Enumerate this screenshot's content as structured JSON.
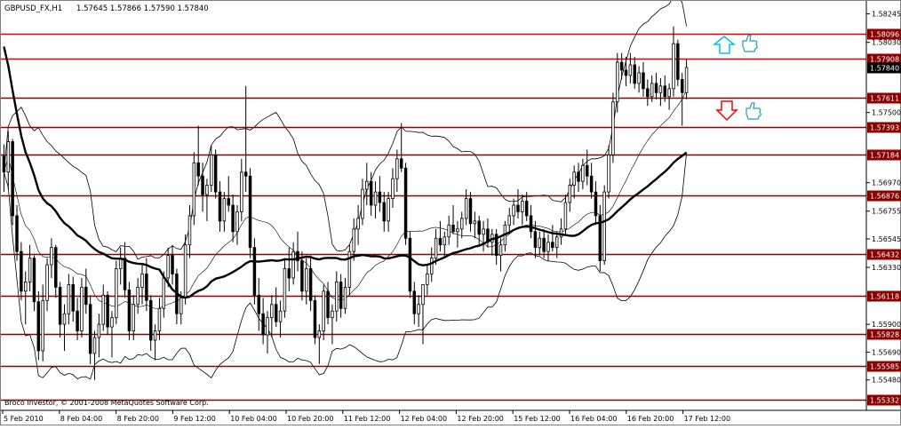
{
  "header": {
    "symbol": "GBPUSD_FX,H1",
    "ohlc": "1.57645 1.57866 1.57590 1.57840"
  },
  "footer": "Broco Investor, © 2001-2008 MetaQuotes Software Corp.",
  "chart_data": {
    "type": "candlestick",
    "title": "GBPUSD_FX,H1",
    "ylim": [
      1.5525,
      1.5835
    ],
    "y_ticks": [
      "1.58245",
      "1.58030",
      "1.57500",
      "1.56970",
      "1.56755",
      "1.56545",
      "1.56330",
      "1.55900",
      "1.55690",
      "1.55480"
    ],
    "x_ticks": [
      "5 Feb 2010",
      "8 Feb 04:00",
      "8 Feb 20:00",
      "9 Feb 12:00",
      "10 Feb 04:00",
      "10 Feb 20:00",
      "11 Feb 12:00",
      "12 Feb 04:00",
      "12 Feb 20:00",
      "15 Feb 12:00",
      "16 Feb 04:00",
      "16 Feb 20:00",
      "17 Feb 12:00"
    ],
    "levels": [
      "1.58096",
      "1.57908",
      "1.57611",
      "1.57393",
      "1.57184",
      "1.56876",
      "1.56432",
      "1.56118",
      "1.55828",
      "1.55585",
      "1.55332"
    ],
    "current_price": "1.57840",
    "colors": {
      "level_line": "#8b0000",
      "level_label_bg": "#8b0000",
      "upper_level_line": "#e00000",
      "current_price_bg": "#000000",
      "candles": "#000000",
      "up_arrow": "#00bfff",
      "down_arrow": "#ff0000"
    },
    "bars": [
      [
        1.5717,
        1.5726,
        1.569,
        1.5705
      ],
      [
        1.5705,
        1.5736,
        1.5692,
        1.5728
      ],
      [
        1.5728,
        1.573,
        1.5665,
        1.5672
      ],
      [
        1.5672,
        1.568,
        1.5638,
        1.5645
      ],
      [
        1.5645,
        1.5652,
        1.5608,
        1.5615
      ],
      [
        1.5615,
        1.563,
        1.559,
        1.5622
      ],
      [
        1.5622,
        1.565,
        1.5615,
        1.564
      ],
      [
        1.564,
        1.5642,
        1.56,
        1.5607
      ],
      [
        1.5607,
        1.5615,
        1.5563,
        1.557
      ],
      [
        1.557,
        1.562,
        1.5562,
        1.5608
      ],
      [
        1.5608,
        1.564,
        1.56,
        1.5635
      ],
      [
        1.5635,
        1.5655,
        1.5625,
        1.5648
      ],
      [
        1.5648,
        1.565,
        1.561,
        1.5618
      ],
      [
        1.5618,
        1.5622,
        1.558,
        1.559
      ],
      [
        1.559,
        1.5605,
        1.557,
        1.5598
      ],
      [
        1.5598,
        1.5628,
        1.559,
        1.562
      ],
      [
        1.562,
        1.5626,
        1.5592,
        1.56
      ],
      [
        1.56,
        1.561,
        1.5578,
        1.5585
      ],
      [
        1.5585,
        1.5625,
        1.558,
        1.5618
      ],
      [
        1.5618,
        1.5632,
        1.5598,
        1.5605
      ],
      [
        1.5605,
        1.5612,
        1.556,
        1.5568
      ],
      [
        1.5568,
        1.5585,
        1.5548,
        1.558
      ],
      [
        1.558,
        1.5598,
        1.5565,
        1.559
      ],
      [
        1.559,
        1.562,
        1.5585,
        1.5612
      ],
      [
        1.5612,
        1.5615,
        1.5582,
        1.5588
      ],
      [
        1.5588,
        1.56,
        1.5565,
        1.5595
      ],
      [
        1.5595,
        1.5638,
        1.559,
        1.5632
      ],
      [
        1.5632,
        1.5648,
        1.562,
        1.564
      ],
      [
        1.564,
        1.5652,
        1.561,
        1.5616
      ],
      [
        1.5616,
        1.5622,
        1.5578,
        1.5585
      ],
      [
        1.5585,
        1.5612,
        1.5578,
        1.5605
      ],
      [
        1.5605,
        1.5625,
        1.5598,
        1.5618
      ],
      [
        1.5618,
        1.5635,
        1.5605,
        1.5628
      ],
      [
        1.5628,
        1.564,
        1.56,
        1.5608
      ],
      [
        1.5608,
        1.5612,
        1.557,
        1.5578
      ],
      [
        1.5578,
        1.559,
        1.5563,
        1.5585
      ],
      [
        1.5585,
        1.561,
        1.5578,
        1.5602
      ],
      [
        1.5602,
        1.563,
        1.5595,
        1.5625
      ],
      [
        1.5625,
        1.5648,
        1.5618,
        1.5642
      ],
      [
        1.5642,
        1.565,
        1.562,
        1.5628
      ],
      [
        1.5628,
        1.5632,
        1.559,
        1.5598
      ],
      [
        1.5598,
        1.5615,
        1.559,
        1.561
      ],
      [
        1.561,
        1.5658,
        1.5605,
        1.565
      ],
      [
        1.565,
        1.568,
        1.564,
        1.5672
      ],
      [
        1.5672,
        1.572,
        1.5665,
        1.5712
      ],
      [
        1.5712,
        1.574,
        1.5695,
        1.5702
      ],
      [
        1.5702,
        1.5712,
        1.5675,
        1.5688
      ],
      [
        1.5688,
        1.57,
        1.5668,
        1.5695
      ],
      [
        1.5695,
        1.5725,
        1.569,
        1.5718
      ],
      [
        1.5718,
        1.5722,
        1.5685,
        1.569
      ],
      [
        1.569,
        1.5698,
        1.566,
        1.5668
      ],
      [
        1.5668,
        1.569,
        1.566,
        1.5685
      ],
      [
        1.5685,
        1.5702,
        1.5675,
        1.568
      ],
      [
        1.568,
        1.5688,
        1.5652,
        1.566
      ],
      [
        1.566,
        1.568,
        1.565,
        1.5675
      ],
      [
        1.5675,
        1.5715,
        1.5668,
        1.5705
      ],
      [
        1.5705,
        1.577,
        1.569,
        1.5702
      ],
      [
        1.5702,
        1.5708,
        1.564,
        1.5648
      ],
      [
        1.5648,
        1.5655,
        1.5605,
        1.5612
      ],
      [
        1.5612,
        1.5625,
        1.5585,
        1.5598
      ],
      [
        1.5598,
        1.561,
        1.5575,
        1.5582
      ],
      [
        1.5582,
        1.56,
        1.5568,
        1.5595
      ],
      [
        1.5595,
        1.5612,
        1.558,
        1.5605
      ],
      [
        1.5605,
        1.5618,
        1.5588,
        1.5592
      ],
      [
        1.5592,
        1.5608,
        1.558,
        1.56
      ],
      [
        1.56,
        1.564,
        1.5595,
        1.5632
      ],
      [
        1.5632,
        1.5648,
        1.5615,
        1.5625
      ],
      [
        1.5625,
        1.5652,
        1.562,
        1.5645
      ],
      [
        1.5645,
        1.566,
        1.563,
        1.5638
      ],
      [
        1.5638,
        1.5645,
        1.5608,
        1.5615
      ],
      [
        1.5615,
        1.564,
        1.5605,
        1.5632
      ],
      [
        1.5632,
        1.5642,
        1.56,
        1.5608
      ],
      [
        1.5608,
        1.5612,
        1.5575,
        1.558
      ],
      [
        1.558,
        1.559,
        1.556,
        1.5585
      ],
      [
        1.5585,
        1.562,
        1.5578,
        1.5615
      ],
      [
        1.5615,
        1.5622,
        1.559,
        1.5595
      ],
      [
        1.5595,
        1.5605,
        1.5575,
        1.56
      ],
      [
        1.56,
        1.563,
        1.5592,
        1.5622
      ],
      [
        1.5622,
        1.5628,
        1.5595,
        1.5602
      ],
      [
        1.5602,
        1.5625,
        1.5598,
        1.5618
      ],
      [
        1.5618,
        1.565,
        1.5612,
        1.5645
      ],
      [
        1.5645,
        1.567,
        1.5638,
        1.5662
      ],
      [
        1.5662,
        1.568,
        1.565,
        1.567
      ],
      [
        1.567,
        1.57,
        1.5665,
        1.5692
      ],
      [
        1.5692,
        1.5712,
        1.568,
        1.5698
      ],
      [
        1.5698,
        1.5705,
        1.5672,
        1.568
      ],
      [
        1.568,
        1.5698,
        1.567,
        1.569
      ],
      [
        1.569,
        1.5702,
        1.5675,
        1.5682
      ],
      [
        1.5682,
        1.569,
        1.566,
        1.5668
      ],
      [
        1.5668,
        1.569,
        1.566,
        1.5685
      ],
      [
        1.5685,
        1.5708,
        1.5678,
        1.57
      ],
      [
        1.57,
        1.5722,
        1.569,
        1.5715
      ],
      [
        1.5715,
        1.5742,
        1.5705,
        1.5708
      ],
      [
        1.5708,
        1.5712,
        1.565,
        1.5655
      ],
      [
        1.5655,
        1.566,
        1.561,
        1.5615
      ],
      [
        1.5615,
        1.5622,
        1.559,
        1.5598
      ],
      [
        1.5598,
        1.5612,
        1.5588,
        1.5605
      ],
      [
        1.5605,
        1.5615,
        1.5575,
        1.562
      ],
      [
        1.562,
        1.5635,
        1.5612,
        1.5628
      ],
      [
        1.5628,
        1.5648,
        1.5622,
        1.564
      ],
      [
        1.564,
        1.5662,
        1.5635,
        1.5655
      ],
      [
        1.5655,
        1.5668,
        1.5645,
        1.565
      ],
      [
        1.565,
        1.566,
        1.564,
        1.5656
      ],
      [
        1.5656,
        1.5672,
        1.565,
        1.5665
      ],
      [
        1.5665,
        1.568,
        1.5658,
        1.566
      ],
      [
        1.566,
        1.5668,
        1.5648,
        1.5662
      ],
      [
        1.5662,
        1.5675,
        1.5655,
        1.567
      ],
      [
        1.567,
        1.5692,
        1.5665,
        1.5685
      ],
      [
        1.5685,
        1.569,
        1.566,
        1.5666
      ],
      [
        1.5666,
        1.5675,
        1.5655,
        1.5668
      ],
      [
        1.5668,
        1.5672,
        1.565,
        1.5658
      ],
      [
        1.5658,
        1.5668,
        1.5645,
        1.5662
      ],
      [
        1.5662,
        1.567,
        1.5648,
        1.5652
      ],
      [
        1.5652,
        1.5662,
        1.5642,
        1.5658
      ],
      [
        1.5658,
        1.5662,
        1.5635,
        1.5642
      ],
      [
        1.5642,
        1.5655,
        1.563,
        1.565
      ],
      [
        1.565,
        1.5668,
        1.5645,
        1.5665
      ],
      [
        1.5665,
        1.5678,
        1.5658,
        1.5672
      ],
      [
        1.5672,
        1.5685,
        1.5665,
        1.568
      ],
      [
        1.568,
        1.5692,
        1.567,
        1.5675
      ],
      [
        1.5675,
        1.5688,
        1.5665,
        1.5683
      ],
      [
        1.5683,
        1.569,
        1.5668,
        1.5672
      ],
      [
        1.5672,
        1.568,
        1.5655,
        1.566
      ],
      [
        1.566,
        1.5668,
        1.564,
        1.5648
      ],
      [
        1.5648,
        1.566,
        1.5642,
        1.5655
      ],
      [
        1.5655,
        1.5662,
        1.564,
        1.5645
      ],
      [
        1.5645,
        1.5658,
        1.5638,
        1.5652
      ],
      [
        1.5652,
        1.5665,
        1.5645,
        1.5648
      ],
      [
        1.5648,
        1.566,
        1.564,
        1.5656
      ],
      [
        1.5656,
        1.567,
        1.565,
        1.5662
      ],
      [
        1.5662,
        1.5688,
        1.5658,
        1.5682
      ],
      [
        1.5682,
        1.57,
        1.5675,
        1.5695
      ],
      [
        1.5695,
        1.571,
        1.5685,
        1.5705
      ],
      [
        1.5705,
        1.5712,
        1.569,
        1.5698
      ],
      [
        1.5698,
        1.5715,
        1.5692,
        1.571
      ],
      [
        1.571,
        1.5722,
        1.5695,
        1.5702
      ],
      [
        1.5702,
        1.5712,
        1.5685,
        1.569
      ],
      [
        1.569,
        1.5698,
        1.5665,
        1.5672
      ],
      [
        1.5672,
        1.568,
        1.563,
        1.5638
      ],
      [
        1.5638,
        1.5695,
        1.5635,
        1.569
      ],
      [
        1.569,
        1.5725,
        1.5685,
        1.5718
      ],
      [
        1.5718,
        1.5765,
        1.5712,
        1.5758
      ],
      [
        1.5758,
        1.5795,
        1.575,
        1.5788
      ],
      [
        1.5788,
        1.5795,
        1.5775,
        1.5782
      ],
      [
        1.5782,
        1.5792,
        1.577,
        1.5778
      ],
      [
        1.5778,
        1.5795,
        1.5772,
        1.5786
      ],
      [
        1.5786,
        1.5792,
        1.5768,
        1.5772
      ],
      [
        1.5772,
        1.5785,
        1.5765,
        1.578
      ],
      [
        1.578,
        1.5788,
        1.5762,
        1.5768
      ],
      [
        1.5768,
        1.5775,
        1.5755,
        1.5762
      ],
      [
        1.5762,
        1.5778,
        1.5758,
        1.5772
      ],
      [
        1.5772,
        1.578,
        1.576,
        1.5765
      ],
      [
        1.5765,
        1.5776,
        1.5755,
        1.577
      ],
      [
        1.577,
        1.5778,
        1.5758,
        1.5762
      ],
      [
        1.5762,
        1.5772,
        1.5752,
        1.5768
      ],
      [
        1.5768,
        1.5815,
        1.5762,
        1.5802
      ],
      [
        1.5802,
        1.5805,
        1.577,
        1.5775
      ],
      [
        1.5775,
        1.578,
        1.574,
        1.5765
      ],
      [
        1.5765,
        1.579,
        1.576,
        1.5784
      ]
    ]
  },
  "signals": {
    "up_arrow": "up-arrow-icon",
    "up_thumb": "thumbs-up-icon",
    "down_arrow": "down-arrow-icon",
    "down_thumb": "thumbs-up-icon"
  }
}
